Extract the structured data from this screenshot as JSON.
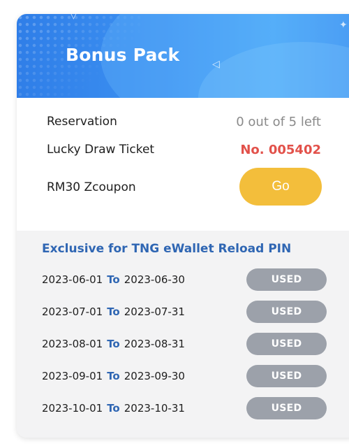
{
  "banner": {
    "title": "Bonus Pack"
  },
  "info": {
    "reservation_label": "Reservation",
    "reservation_value": "0 out of 5 left",
    "ticket_label": "Lucky Draw Ticket",
    "ticket_value": "No. 005402",
    "coupon_label": "RM30 Zcoupon",
    "go_label": "Go"
  },
  "pins": {
    "title": "Exclusive for TNG eWallet Reload PIN",
    "to_label": "To",
    "used_label": "USED",
    "rows": [
      {
        "start": "2023-06-01",
        "end": "2023-06-30"
      },
      {
        "start": "2023-07-01",
        "end": "2023-07-31"
      },
      {
        "start": "2023-08-01",
        "end": "2023-08-31"
      },
      {
        "start": "2023-09-01",
        "end": "2023-09-30"
      },
      {
        "start": "2023-10-01",
        "end": "2023-10-31"
      }
    ]
  },
  "colors": {
    "banner_blue": "#3d92f2",
    "ticket_red": "#e2514a",
    "go_yellow": "#f3be3b",
    "title_blue": "#2f66b3",
    "used_gray": "#9ca1aa"
  }
}
